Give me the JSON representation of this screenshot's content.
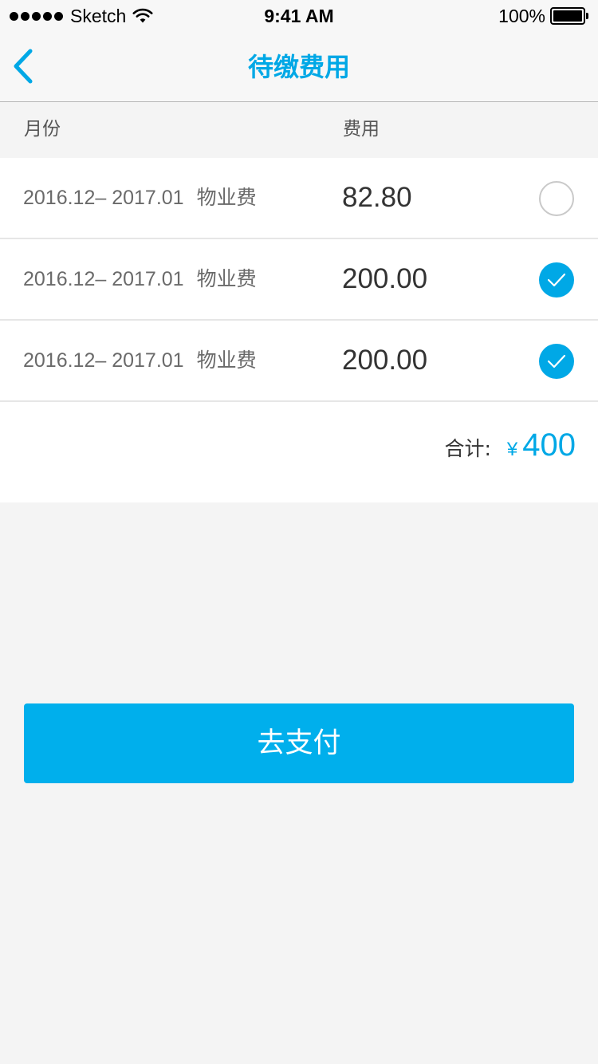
{
  "status_bar": {
    "carrier": "Sketch",
    "time": "9:41 AM",
    "battery": "100%"
  },
  "nav": {
    "title": "待缴费用",
    "back_icon": "chevron-left-icon"
  },
  "columns": {
    "month": "月份",
    "fee": "费用"
  },
  "fees": [
    {
      "period": "2016.12– 2017.01",
      "type": "物业费",
      "amount": "82.80",
      "checked": false
    },
    {
      "period": "2016.12– 2017.01",
      "type": "物业费",
      "amount": "200.00",
      "checked": true
    },
    {
      "period": "2016.12– 2017.01",
      "type": "物业费",
      "amount": "200.00",
      "checked": true
    }
  ],
  "total": {
    "label": "合计:",
    "currency": "¥",
    "amount": "400"
  },
  "pay_button": {
    "label": "去支付"
  },
  "colors": {
    "accent": "#00a8e6",
    "button": "#00afec",
    "background": "#f4f4f4"
  }
}
